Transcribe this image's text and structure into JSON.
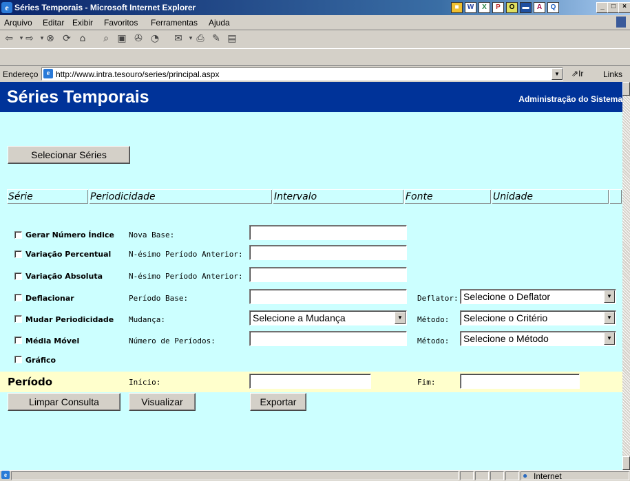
{
  "window": {
    "title": "Séries Temporais - Microsoft Internet Explorer",
    "controls": {
      "minimize": "_",
      "maximize": "□",
      "close": "×"
    }
  },
  "menu": [
    "Arquivo",
    "Editar",
    "Exibir",
    "Favoritos",
    "Ferramentas",
    "Ajuda"
  ],
  "toolbar": {
    "icons": [
      "back-icon",
      "forward-icon",
      "stop-icon",
      "refresh-icon",
      "home-icon",
      "search-icon",
      "favorites-icon",
      "history-icon",
      "media-icon",
      "mail-icon",
      "print-icon",
      "edit-icon",
      "discuss-icon"
    ]
  },
  "address": {
    "label": "Endereço",
    "url": "http://www.intra.tesouro/series/principal.aspx",
    "go_label": "Ir",
    "links_label": "Links"
  },
  "page": {
    "title": "Séries Temporais",
    "admin_link": "Administração do Sistema",
    "select_series_button": "Selecionar Séries",
    "columns": [
      "Série",
      "Periodicidade",
      "Intervalo",
      "Fonte",
      "Unidade"
    ],
    "options": {
      "gerar_indice": {
        "label": "Gerar Número Índice",
        "field_label": "Nova Base:",
        "value": ""
      },
      "var_percentual": {
        "label": "Variação Percentual",
        "field_label": "N-ésimo Período Anterior:",
        "value": ""
      },
      "var_absoluta": {
        "label": "Variação Absoluta",
        "field_label": "N-ésimo Período Anterior:",
        "value": ""
      },
      "deflacionar": {
        "label": "Deflacionar",
        "field_label": "Período Base:",
        "value": "",
        "extra_label": "Deflator:",
        "extra_select": "Selecione o Deflator"
      },
      "mudar_periodicidade": {
        "label": "Mudar Periodicidade",
        "field_label": "Mudança:",
        "select": "Selecione a Mudança",
        "extra_label": "Método:",
        "extra_select": "Selecione o Critério"
      },
      "media_movel": {
        "label": "Média Móvel",
        "field_label": "Número de Períodos:",
        "value": "",
        "extra_label": "Método:",
        "extra_select": "Selecione o Método"
      },
      "grafico": {
        "label": "Gráfico"
      }
    },
    "periodo": {
      "label": "Período",
      "inicio_label": "Início:",
      "inicio_value": "",
      "fim_label": "Fim:",
      "fim_value": ""
    },
    "buttons": {
      "limpar": "Limpar Consulta",
      "visualizar": "Visualizar",
      "exportar": "Exportar"
    }
  },
  "status": {
    "zone": "Internet"
  }
}
